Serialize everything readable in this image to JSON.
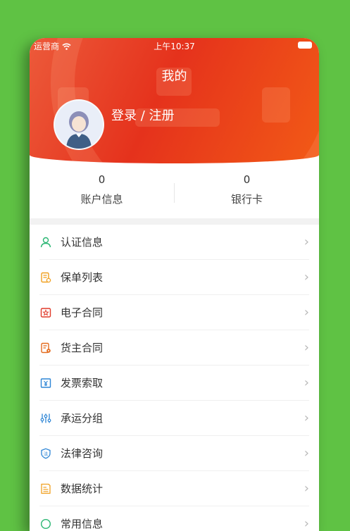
{
  "status_bar": {
    "carrier": "运营商",
    "time": "上午10:37"
  },
  "header": {
    "title": "我的",
    "login_text": "登录 / 注册"
  },
  "stats": [
    {
      "value": "0",
      "label": "账户信息"
    },
    {
      "value": "0",
      "label": "银行卡"
    }
  ],
  "menu": [
    {
      "label": "认证信息",
      "icon": "user-icon",
      "color": "#2bb673"
    },
    {
      "label": "保单列表",
      "icon": "policy-list-icon",
      "color": "#f0a020"
    },
    {
      "label": "电子合同",
      "icon": "e-contract-icon",
      "color": "#e03a2a"
    },
    {
      "label": "货主合同",
      "icon": "shipper-contract-icon",
      "color": "#e36a1c"
    },
    {
      "label": "发票索取",
      "icon": "invoice-icon",
      "color": "#2e86d6"
    },
    {
      "label": "承运分组",
      "icon": "group-icon",
      "color": "#2e86d6"
    },
    {
      "label": "法律咨询",
      "icon": "legal-shield-icon",
      "color": "#2e86d6"
    },
    {
      "label": "数据统计",
      "icon": "statistics-icon",
      "color": "#f0a020"
    },
    {
      "label": "常用信息",
      "icon": "info-icon",
      "color": "#2bb673"
    }
  ],
  "colors": {
    "background": "#5fc244",
    "header_red": "#e5321c",
    "header_orange": "#f25a16"
  }
}
